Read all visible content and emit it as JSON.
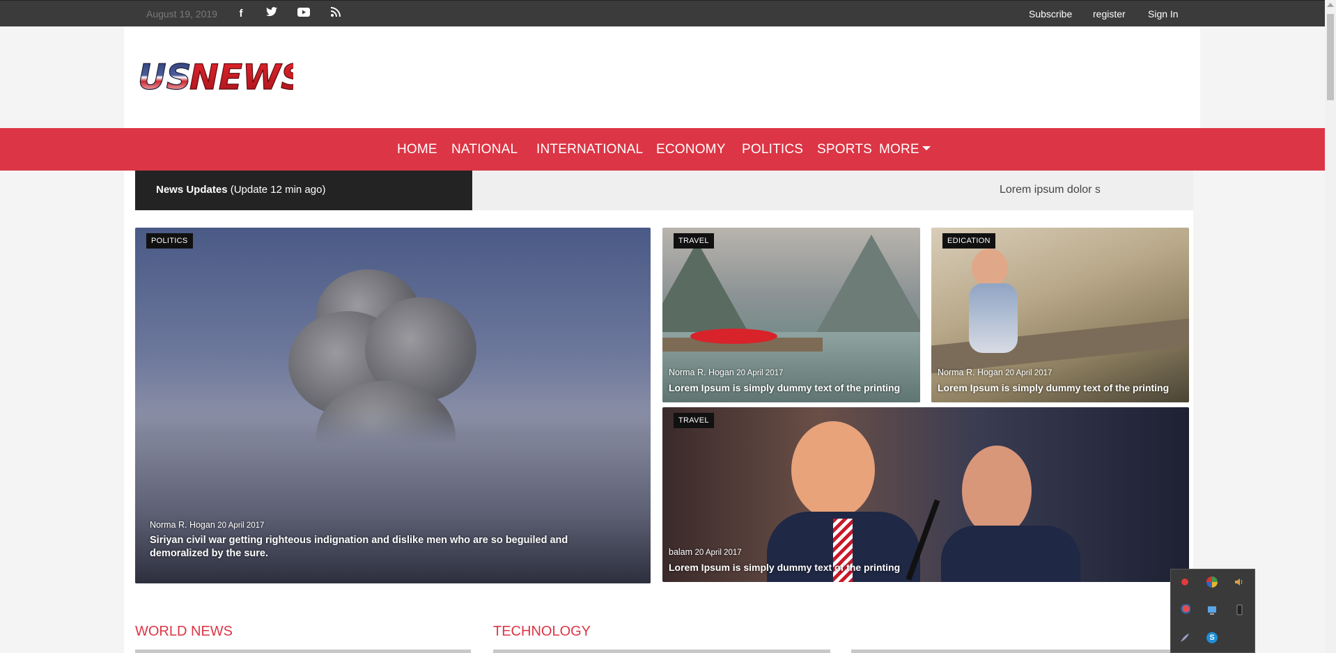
{
  "topbar": {
    "date": "August 19, 2019",
    "social": [
      {
        "name": "facebook-icon",
        "glyph": "f"
      },
      {
        "name": "twitter-icon",
        "glyph": "🐦"
      },
      {
        "name": "youtube-icon",
        "glyph": "▶"
      },
      {
        "name": "rss-icon",
        "glyph": "◉"
      }
    ],
    "links": [
      "Subscribe",
      "register",
      "Sign In"
    ]
  },
  "logo": {
    "text_us": "US",
    "text_news": "NEWS"
  },
  "nav": {
    "items": [
      "HOME",
      "NATIONAL",
      "INTERNATIONAL",
      "ECONOMY",
      "POLITICS",
      "SPORTS",
      "MORE"
    ]
  },
  "ticker": {
    "label_bold": "News Updates",
    "label_rest": " (Update 12 min ago)",
    "text": "Lorem ipsum dolor s"
  },
  "cards": [
    {
      "category": "POLITICS",
      "author": "Norma R. Hogan",
      "date": "20 April 2017",
      "title": "Siriyan civil war getting righteous indignation and dislike men who are so beguiled and demoralized by the sure."
    },
    {
      "category": "TRAVEL",
      "author": "Norma R. Hogan",
      "date": "20 April 2017",
      "title": "Lorem Ipsum is simply dummy text of the printing"
    },
    {
      "category": "EDICATION",
      "author": "Norma R. Hogan",
      "date": "20 April 2017",
      "title": "Lorem Ipsum is simply dummy text of the printing"
    },
    {
      "category": "TRAVEL",
      "author": "balam",
      "date": "20 April 2017",
      "title": "Lorem Ipsum is simply dummy text of the printing"
    }
  ],
  "sections": [
    "WORLD NEWS",
    "TECHNOLOGY"
  ],
  "colors": {
    "brand_red": "#dc3545",
    "topbar": "#3b3b3b",
    "ticker_dark": "#232323"
  }
}
